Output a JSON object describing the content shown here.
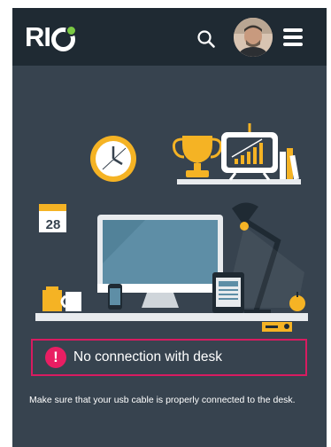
{
  "header": {
    "logo_text": "RIO",
    "icons": [
      "search-icon",
      "avatar",
      "hamburger-menu-icon"
    ]
  },
  "illustration": {
    "calendar_day": "28"
  },
  "error": {
    "icon": "exclamation-icon",
    "icon_glyph": "!",
    "message": "No connection with desk"
  },
  "help": {
    "text": "Make sure that your usb cable is properly connected to the desk."
  },
  "colors": {
    "header_bg": "#1f2a33",
    "screen_bg": "#37434f",
    "accent_green": "#7ac943",
    "alert": "#e91e63",
    "illustration_yellow": "#f5b324"
  }
}
